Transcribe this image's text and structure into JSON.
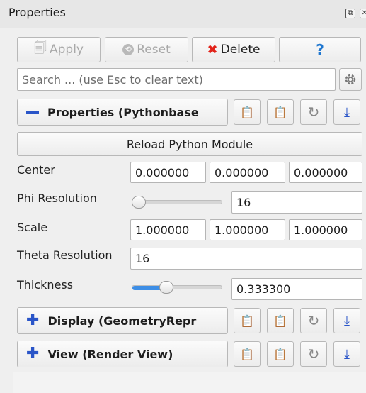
{
  "panel": {
    "title": "Properties"
  },
  "toolbar": {
    "apply_label": "Apply",
    "reset_label": "Reset",
    "delete_label": "Delete",
    "help_label": "?"
  },
  "search": {
    "placeholder": "Search ... (use Esc to clear text)"
  },
  "sections": {
    "properties": "Properties (Pythonbase",
    "display": "Display (GeometryRepr",
    "view": "View (Render View)"
  },
  "reload_button": "Reload Python Module",
  "props": {
    "center": {
      "label": "Center",
      "values": [
        "0.000000",
        "0.000000",
        "0.000000"
      ]
    },
    "phi": {
      "label": "Phi Resolution",
      "value": "16",
      "slider_fraction": 0.03
    },
    "scale": {
      "label": "Scale",
      "values": [
        "1.000000",
        "1.000000",
        "1.000000"
      ]
    },
    "theta": {
      "label": "Theta Resolution",
      "value": "16"
    },
    "thickness": {
      "label": "Thickness",
      "value": "0.333300",
      "slider_fraction": 0.333
    }
  },
  "colors": {
    "accent": "#3d8ee6",
    "delete_x": "#e2231a",
    "help": "#1f77d0"
  },
  "icons": [
    "apply-icon",
    "reset-icon",
    "delete-x-icon",
    "help-icon",
    "gear-icon",
    "copy-icon",
    "paste-icon",
    "restore-icon",
    "save-default-icon",
    "collapse-minus-icon",
    "expand-plus-icon"
  ]
}
